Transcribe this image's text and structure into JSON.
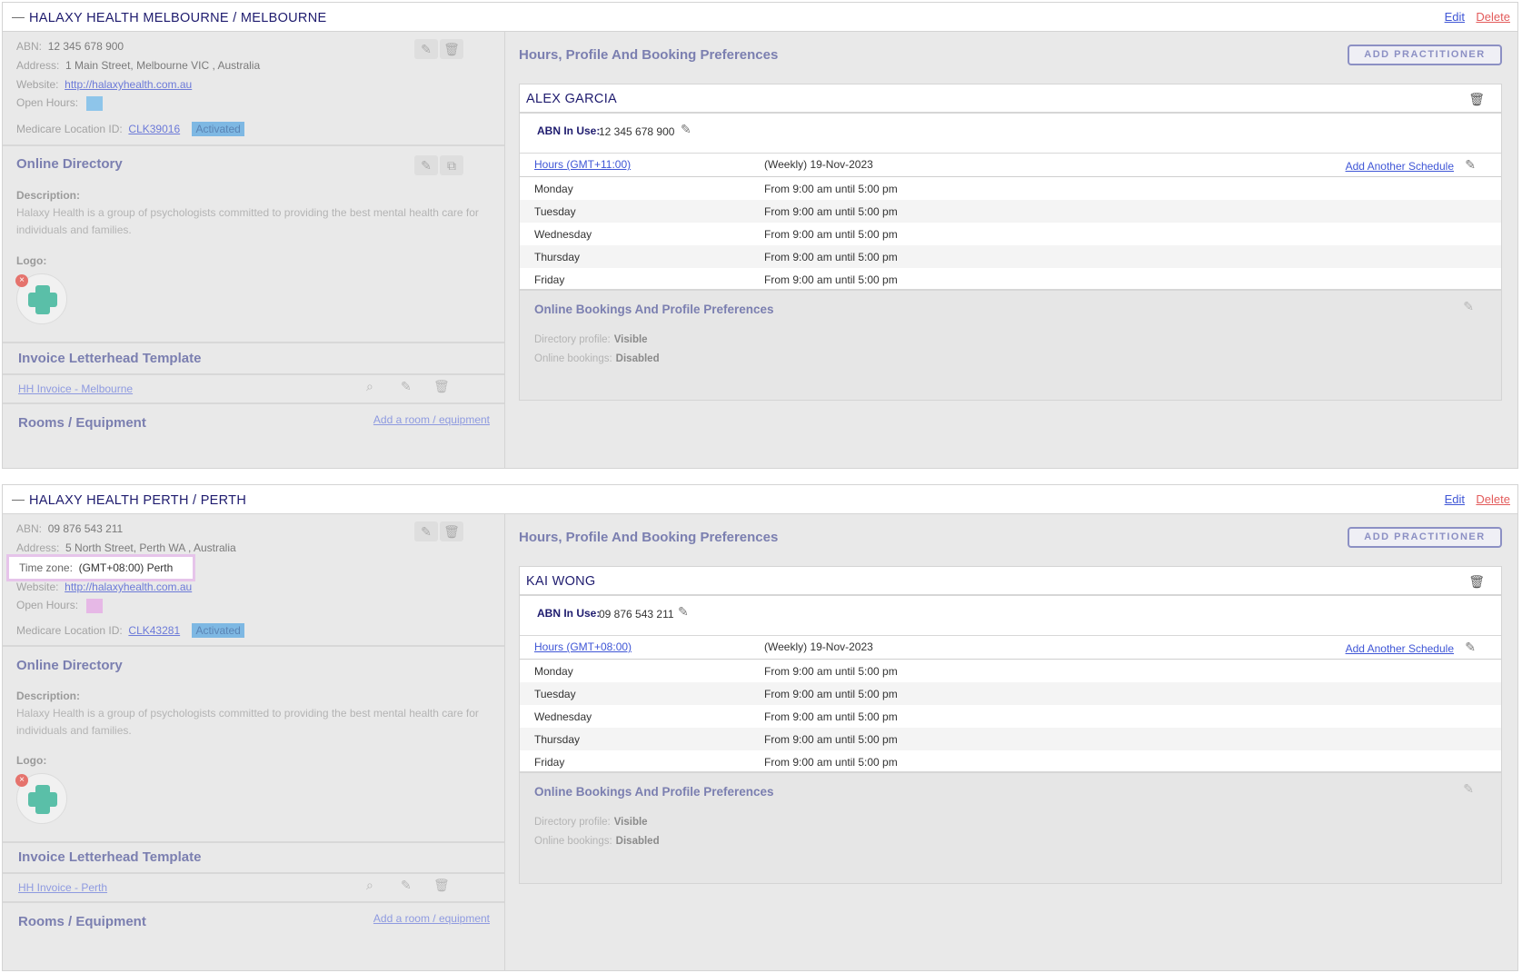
{
  "locations": [
    {
      "title": "HALAXY HEALTH MELBOURNE / MELBOURNE",
      "edit": "Edit",
      "delete": "Delete",
      "abn_label": "ABN:",
      "abn": "12 345 678 900",
      "address_label": "Address:",
      "address": "1 Main Street, Melbourne VIC , Australia",
      "timezone_label": "",
      "timezone": "",
      "website_label": "Website:",
      "website": "http://halaxyhealth.com.au",
      "open_hours_label": "Open Hours:",
      "open_hours_color": "#8ec5ea",
      "medicare_label": "Medicare Location ID:",
      "medicare_id": "CLK39016",
      "medicare_status": "Activated",
      "online_directory": "Online Directory",
      "description_label": "Description:",
      "description": "Halaxy Health is a group of psychologists committed to providing the best mental health care for individuals and families.",
      "logo_label": "Logo:",
      "invoice_title": "Invoice Letterhead Template",
      "invoice_template": "HH Invoice - Melbourne",
      "rooms_title": "Rooms / Equipment",
      "rooms_link": "Add a room / equipment",
      "right_title": "Hours, Profile And Booking Preferences",
      "add_practitioner": "ADD PRACTITIONER",
      "practitioner": {
        "name": "ALEX GARCIA",
        "abn_label": "ABN In Use:",
        "abn": "12 345 678 900",
        "hours_tz": "Hours (GMT+11:00)",
        "schedule": "(Weekly) 19-Nov-2023",
        "add_schedule": "Add Another Schedule",
        "days": [
          {
            "day": "Monday",
            "time": "From 9:00 am until 5:00 pm"
          },
          {
            "day": "Tuesday",
            "time": "From 9:00 am until 5:00 pm"
          },
          {
            "day": "Wednesday",
            "time": "From 9:00 am until 5:00 pm"
          },
          {
            "day": "Thursday",
            "time": "From 9:00 am until 5:00 pm"
          },
          {
            "day": "Friday",
            "time": "From 9:00 am until 5:00 pm"
          }
        ],
        "online_title": "Online Bookings And Profile Preferences",
        "directory_profile_label": "Directory profile:",
        "directory_profile": "Visible",
        "online_bookings_label": "Online bookings:",
        "online_bookings": "Disabled"
      }
    },
    {
      "title": "HALAXY HEALTH PERTH / PERTH",
      "edit": "Edit",
      "delete": "Delete",
      "abn_label": "ABN:",
      "abn": "09 876 543 211",
      "address_label": "Address:",
      "address": "5 North Street, Perth WA , Australia",
      "timezone_label": "Time zone:",
      "timezone": "(GMT+08:00) Perth",
      "website_label": "Website:",
      "website": "http://halaxyhealth.com.au",
      "open_hours_label": "Open Hours:",
      "open_hours_color": "#e6b8e6",
      "medicare_label": "Medicare Location ID:",
      "medicare_id": "CLK43281",
      "medicare_status": "Activated",
      "online_directory": "Online Directory",
      "description_label": "Description:",
      "description": "Halaxy Health is a group of psychologists committed to providing the best mental health care for individuals and families.",
      "logo_label": "Logo:",
      "invoice_title": "Invoice Letterhead Template",
      "invoice_template": "HH Invoice - Perth",
      "rooms_title": "Rooms / Equipment",
      "rooms_link": "Add a room / equipment",
      "right_title": "Hours, Profile And Booking Preferences",
      "add_practitioner": "ADD PRACTITIONER",
      "practitioner": {
        "name": "KAI WONG",
        "abn_label": "ABN In Use:",
        "abn": "09 876 543 211",
        "hours_tz": "Hours (GMT+08:00)",
        "schedule": "(Weekly) 19-Nov-2023",
        "add_schedule": "Add Another Schedule",
        "days": [
          {
            "day": "Monday",
            "time": "From 9:00 am until 5:00 pm"
          },
          {
            "day": "Tuesday",
            "time": "From 9:00 am until 5:00 pm"
          },
          {
            "day": "Wednesday",
            "time": "From 9:00 am until 5:00 pm"
          },
          {
            "day": "Thursday",
            "time": "From 9:00 am until 5:00 pm"
          },
          {
            "day": "Friday",
            "time": "From 9:00 am until 5:00 pm"
          }
        ],
        "online_title": "Online Bookings And Profile Preferences",
        "directory_profile_label": "Directory profile:",
        "directory_profile": "Visible",
        "online_bookings_label": "Online bookings:",
        "online_bookings": "Disabled"
      }
    }
  ]
}
